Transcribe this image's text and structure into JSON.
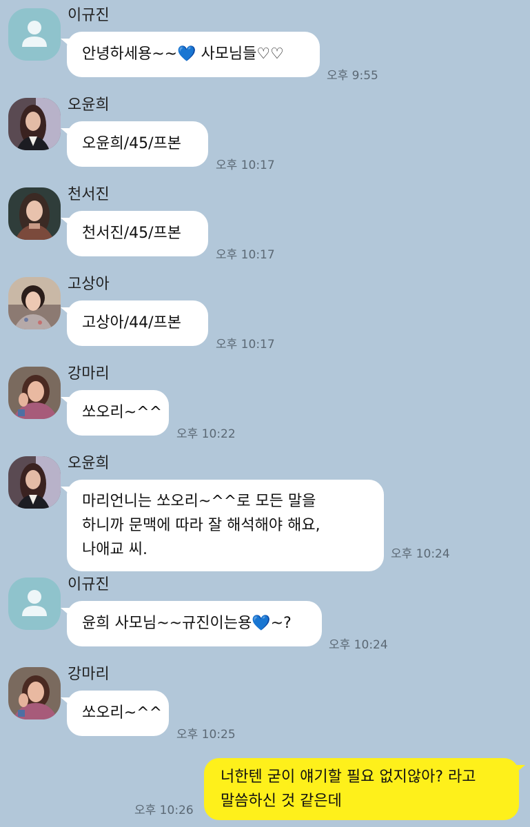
{
  "messages": [
    {
      "sender": "이규진",
      "avatar": "default",
      "lines": [
        "안녕하세용~~💙 사모님들♡♡"
      ],
      "time": "오후 9:55"
    },
    {
      "sender": "오윤희",
      "avatar": "photo-yunhee",
      "lines": [
        "오윤희/45/프본"
      ],
      "time": "오후 10:17"
    },
    {
      "sender": "천서진",
      "avatar": "photo-seojin",
      "lines": [
        "천서진/45/프본"
      ],
      "time": "오후 10:17"
    },
    {
      "sender": "고상아",
      "avatar": "photo-sanga",
      "lines": [
        "고상아/44/프본"
      ],
      "time": "오후 10:17"
    },
    {
      "sender": "강마리",
      "avatar": "photo-mari",
      "lines": [
        "쏘오리~^^"
      ],
      "time": "오후 10:22"
    },
    {
      "sender": "오윤희",
      "avatar": "photo-yunhee",
      "lines": [
        "마리언니는 쏘오리~^^로 모든 말을",
        "하니까 문맥에 따라 잘 해석해야 해요,",
        "나애교 씨."
      ],
      "time": "오후 10:24"
    },
    {
      "sender": "이규진",
      "avatar": "default",
      "lines": [
        "윤희 사모님~~규진이는용💙~?"
      ],
      "time": "오후 10:24"
    },
    {
      "sender": "강마리",
      "avatar": "photo-mari",
      "lines": [
        "쏘오리~^^"
      ],
      "time": "오후 10:25"
    }
  ],
  "my_message": {
    "lines": [
      "너한텐 굳이 얘기할 필요 없지않아? 라고",
      "말씀하신 것 같은데"
    ],
    "time": "오후 10:26"
  },
  "colors": {
    "background": "#b2c7d9",
    "incoming_bubble": "#ffffff",
    "outgoing_bubble": "#fef01b",
    "default_avatar": "#8fc3cc"
  }
}
